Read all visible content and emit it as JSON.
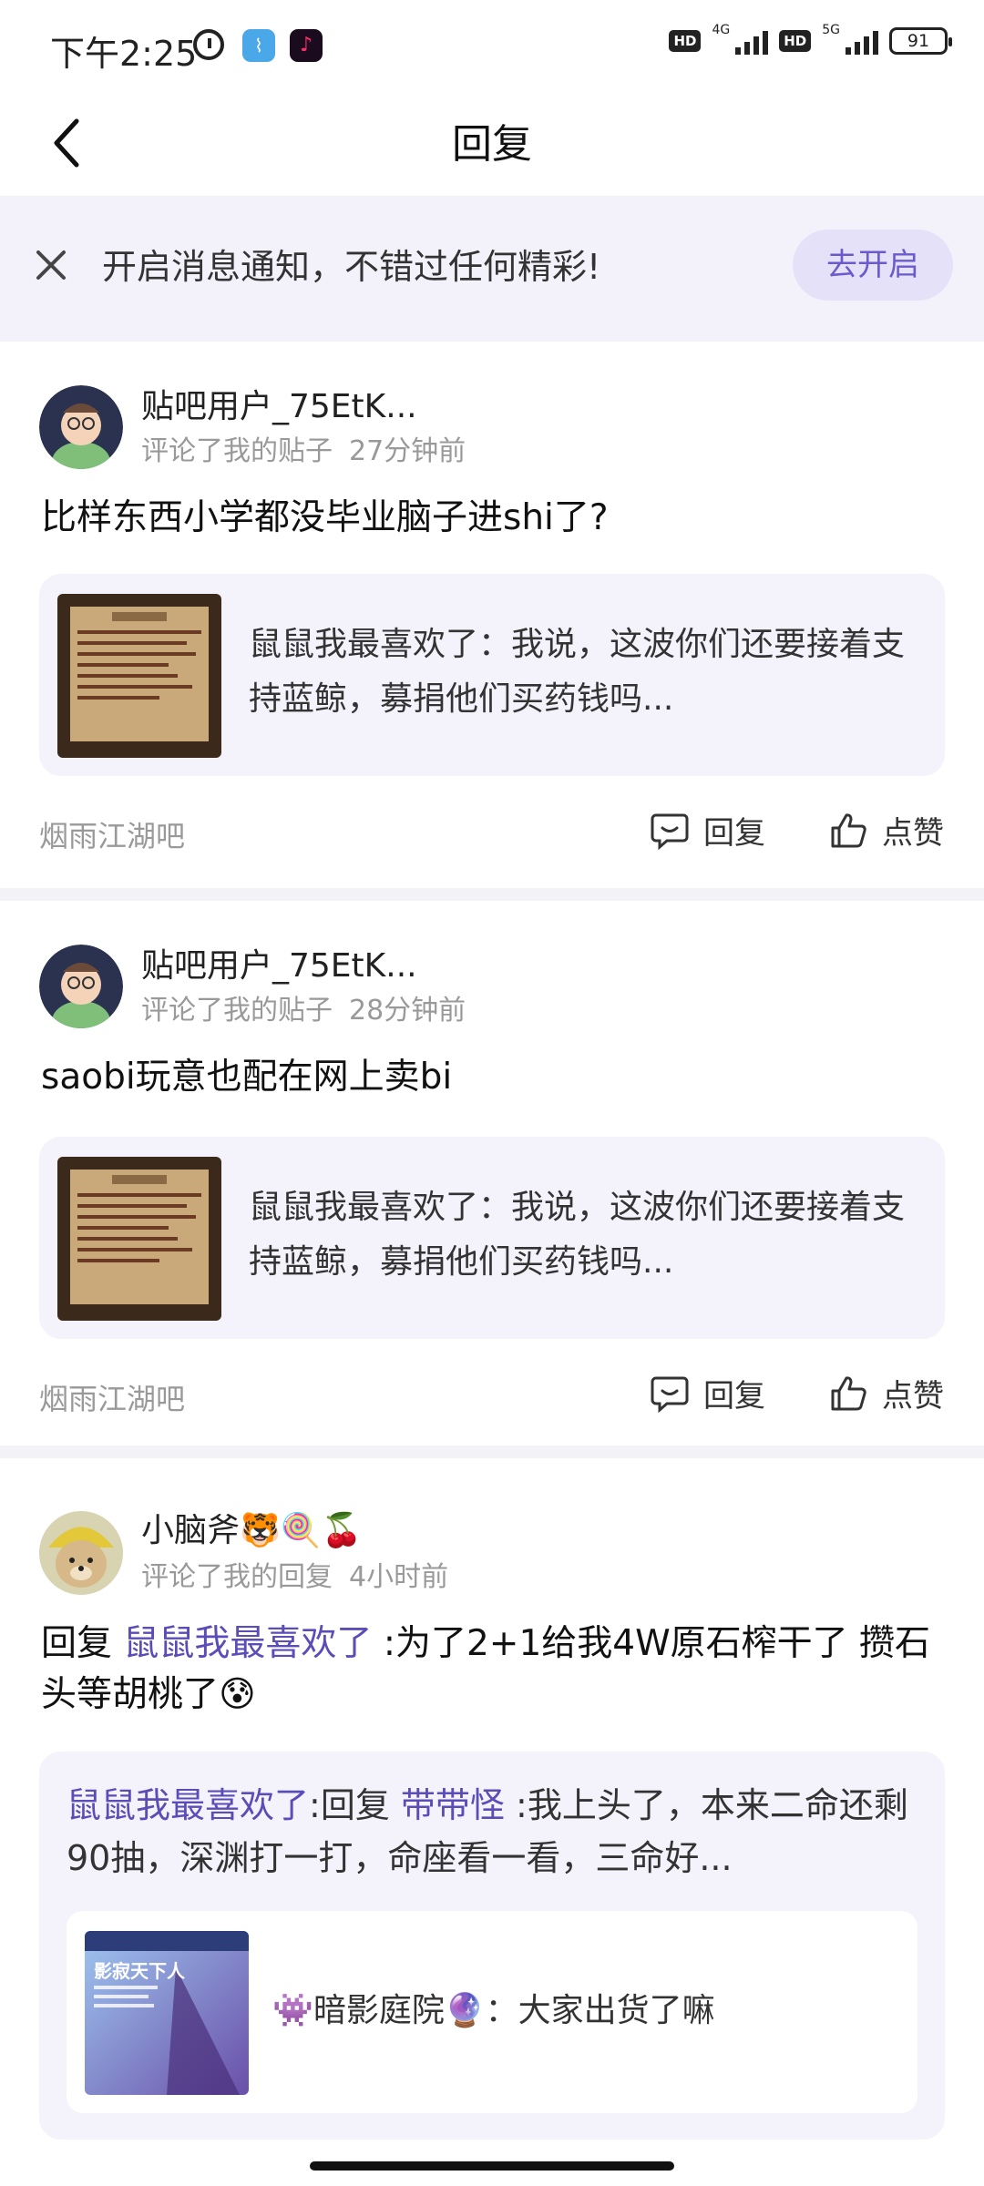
{
  "status_bar": {
    "time": "下午2:25",
    "network_1": "4G",
    "network_2": "5G",
    "hd_label": "HD",
    "battery": "91"
  },
  "header": {
    "title": "回复"
  },
  "notice": {
    "text": "开启消息通知，不错过任何精彩!",
    "button": "去开启"
  },
  "replies": [
    {
      "username": "贴吧用户_75EtK...",
      "action": "评论了我的贴子",
      "time": "27分钟前",
      "content": "比样东西小学都没毕业脑子进shi了?",
      "quote": "鼠鼠我最喜欢了：我说，这波你们还要接着支持蓝鲸，募捐他们买药钱吗...",
      "forum": "烟雨江湖吧",
      "reply_label": "回复",
      "like_label": "点赞"
    },
    {
      "username": "贴吧用户_75EtK...",
      "action": "评论了我的贴子",
      "time": "28分钟前",
      "content": "saobi玩意也配在网上卖bi",
      "quote": "鼠鼠我最喜欢了：我说，这波你们还要接着支持蓝鲸，募捐他们买药钱吗...",
      "forum": "烟雨江湖吧",
      "reply_label": "回复",
      "like_label": "点赞"
    },
    {
      "username": "小脑斧🐯🍭🍒",
      "action": "评论了我的回复",
      "time": "4小时前",
      "content_prefix": "回复",
      "content_mention": "鼠鼠我最喜欢了",
      "content_rest": ":为了2+1给我4W原石榨干了 攒石头等胡桃了😰",
      "quote_mention": "鼠鼠我最喜欢了",
      "quote_mid": ":回复",
      "quote_mention2": "带带怪",
      "quote_rest": ":我上头了，本来二命还剩90抽，深渊打一打，命座看一看，三命好...",
      "inner_text": "👾暗影庭院🔮：大家出货了嘛",
      "inner_thumb_text": "影寂天下人"
    }
  ],
  "colors": {
    "accent": "#5b4db8",
    "banner_bg": "#f3f2fb",
    "quote_bg": "#f4f3fb"
  }
}
